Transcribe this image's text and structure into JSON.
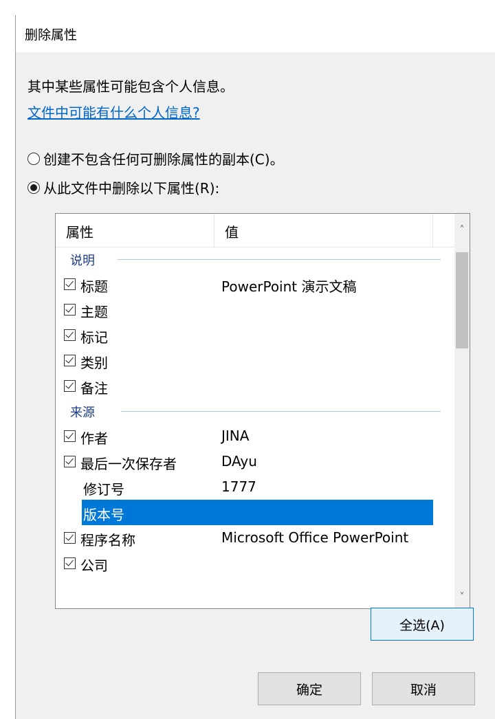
{
  "dialog": {
    "title": "删除属性",
    "info_text": "其中某些属性可能包含个人信息。",
    "help_link": "文件中可能有什么个人信息?"
  },
  "options": {
    "copy_label": "创建不包含任何可删除属性的副本(C)。",
    "remove_label": "从此文件中删除以下属性(R):",
    "selected": "remove"
  },
  "listview": {
    "columns": [
      "属性",
      "值"
    ],
    "groups": [
      {
        "name": "说明",
        "items": [
          {
            "name": "标题",
            "value": "PowerPoint 演示文稿",
            "checked": true
          },
          {
            "name": "主题",
            "value": "",
            "checked": true
          },
          {
            "name": "标记",
            "value": "",
            "checked": true
          },
          {
            "name": "类别",
            "value": "",
            "checked": true
          },
          {
            "name": "备注",
            "value": "",
            "checked": true
          }
        ]
      },
      {
        "name": "来源",
        "items": [
          {
            "name": "作者",
            "value": "JINA",
            "checked": true
          },
          {
            "name": "最后一次保存者",
            "value": "DAyu",
            "checked": true
          },
          {
            "name": "修订号",
            "value": "1777",
            "checked": false
          },
          {
            "name": "版本号",
            "value": "",
            "checked": false,
            "selected": true
          },
          {
            "name": "程序名称",
            "value": "Microsoft Office PowerPoint",
            "checked": true
          },
          {
            "name": "公司",
            "value": "",
            "checked": true
          }
        ]
      }
    ]
  },
  "buttons": {
    "select_all": "全选(A)",
    "ok": "确定",
    "cancel": "取消"
  },
  "colors": {
    "selection": "#0078d7",
    "link": "#0066cc",
    "group_header": "#1e3b8a",
    "dialog_bg": "#f0f0f0"
  }
}
